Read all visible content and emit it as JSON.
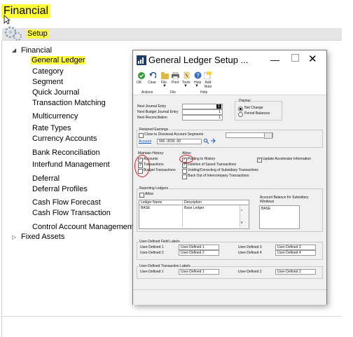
{
  "app_title": "Financial",
  "setup_label": "Setup",
  "tree": {
    "financial": "Financial",
    "items": [
      "General Ledger",
      "Category",
      "Segment",
      "Quick Journal",
      "Transaction Matching",
      "Multicurrency",
      "Rate Types",
      "Currency Accounts",
      "Bank Reconciliation",
      "Interfund Management",
      "Deferral",
      "Deferral Profiles",
      "Cash Flow Forecast",
      "Cash Flow Transaction",
      "Control Account Management"
    ],
    "fixed_assets": "Fixed Assets"
  },
  "dialog": {
    "title": "General Ledger Setup ...",
    "ribbon": {
      "buttons": [
        "OK",
        "Clear",
        "File",
        "Print",
        "Tools",
        "Help",
        "Add Note"
      ],
      "groups": [
        "Actions",
        "File",
        "Help"
      ]
    },
    "next_journal_entry_label": "Next Journal Entry",
    "next_journal_entry_value": "1",
    "next_budget_label": "Next Budget Journal Entry",
    "next_budget_value": "1",
    "next_recon_label": "Next Reconciliation",
    "next_recon_value": "1",
    "display_label": "Display:",
    "display_options": [
      "Net Change",
      "Period Balances"
    ],
    "retained_label": "Retained Earnings",
    "close_divisional": "Close to Divisional Account Segments",
    "account_link": "Account",
    "account_value": "000 -3030 -00",
    "maintain_history": "Maintain History:",
    "mh_options": [
      "Accounts",
      "Transactions",
      "Budget Transactions"
    ],
    "allow_label": "Allow:",
    "allow_options": [
      "Posting to History",
      "Deletion of Saved Transactions",
      "Voiding/Correcting of Subsidiary Transactions",
      "Back Out of Intercompany Transactions"
    ],
    "update_accel": "Update Accelerator Information",
    "reporting_ledgers": "Reporting Ledgers",
    "rl_allow": "Allow",
    "ledger_name_header": "Ledger Name",
    "description_header": "Description",
    "ledger_row": {
      "name": "BASE",
      "description": "Base Ledger"
    },
    "account_balance_label": "Account Balance for Subsidiary Windows",
    "account_balance_value": "BASE",
    "udf_title": "User-Defined Field Labels",
    "udf": [
      {
        "label": "User-Defined 1",
        "value": "User-Defined 1"
      },
      {
        "label": "User-Defined 2",
        "value": "User-Defined 2"
      },
      {
        "label": "User-Defined 3",
        "value": "User-Defined 3"
      },
      {
        "label": "User-Defined 4",
        "value": "User-Defined 4"
      }
    ],
    "udt_title": "User-Defined Transaction Labels",
    "udt": [
      {
        "label": "User-Defined 1",
        "value": "User-Defined 1"
      },
      {
        "label": "User-Defined 2",
        "value": "User-Defined 2"
      }
    ]
  }
}
